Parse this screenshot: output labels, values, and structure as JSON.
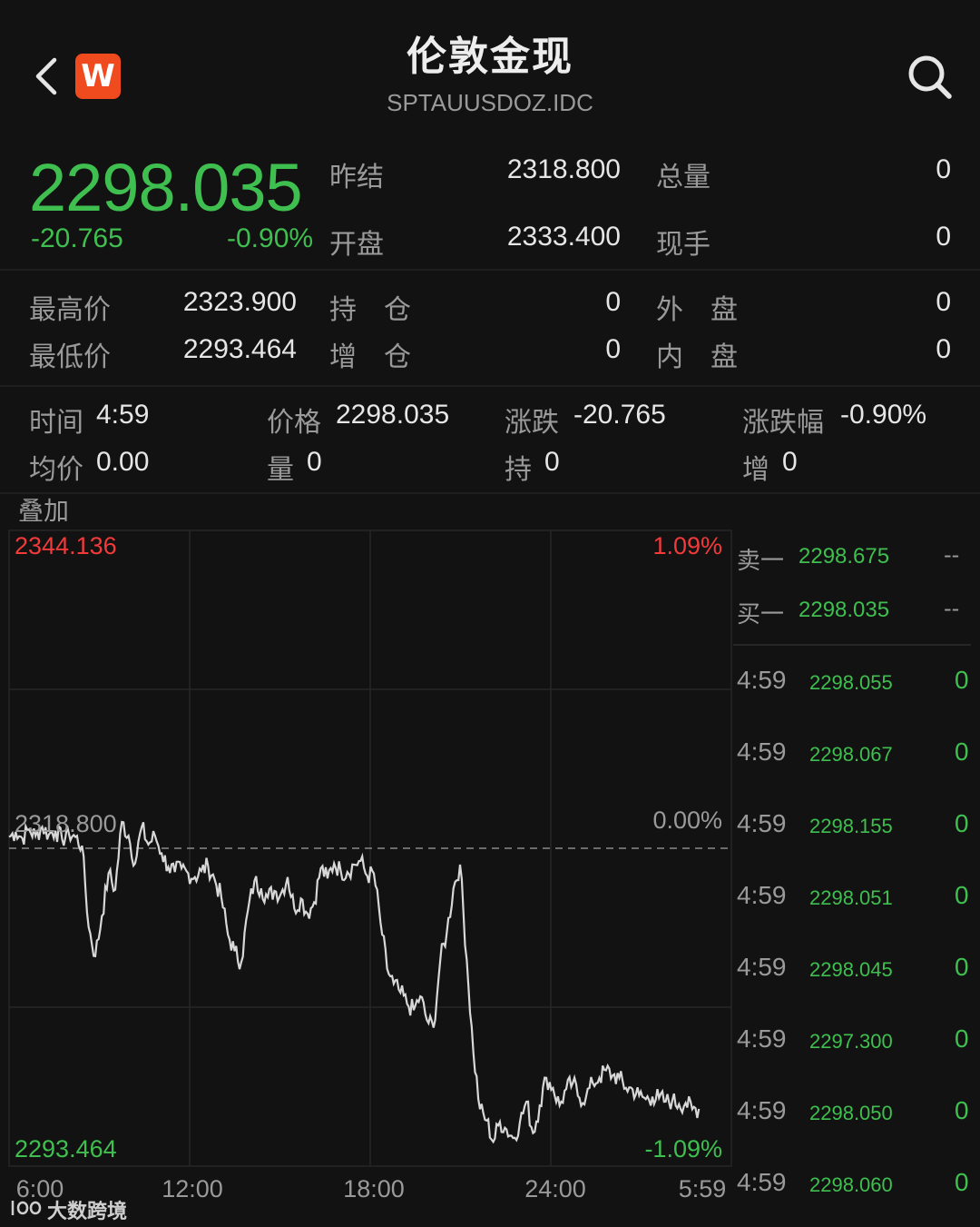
{
  "header": {
    "title": "伦敦金现",
    "subtitle": "SPTAUUSDOZ.IDC",
    "brand_letter": "W"
  },
  "quote": {
    "last": "2298.035",
    "change": "-20.765",
    "change_pct": "-0.90%",
    "prev_settle_label": "昨结",
    "prev_settle": "2318.800",
    "total_vol_label": "总量",
    "total_vol": "0",
    "open_label": "开盘",
    "open": "2333.400",
    "current_hand_label": "现手",
    "current_hand": "0"
  },
  "stats": {
    "high_label": "最高价",
    "high": "2323.900",
    "low_label": "最低价",
    "low": "2293.464",
    "hold_label": "持　仓",
    "hold": "0",
    "add_label": "增　仓",
    "add": "0",
    "outer_label": "外　盘",
    "outer": "0",
    "inner_label": "内　盘",
    "inner": "0"
  },
  "cursor": {
    "time_label": "时间",
    "time": "4:59",
    "price_label": "价格",
    "price": "2298.035",
    "chg_label": "涨跌",
    "chg": "-20.765",
    "chg_pct_label": "涨跌幅",
    "chg_pct": "-0.90%",
    "avg_label": "均价",
    "avg": "0.00",
    "vol_label": "量",
    "vol": "0",
    "hold_label": "持",
    "hold": "0",
    "add_label": "增",
    "add": "0"
  },
  "overlay_label": "叠加",
  "chart_data": {
    "type": "line",
    "y_max_label": "2344.136",
    "y_min_label": "2293.464",
    "y_max_pct": "1.09%",
    "y_min_pct": "-1.09%",
    "ref_label": "2318.800",
    "ref_pct": "0.00%",
    "ylim": [
      2293.464,
      2344.136
    ],
    "reference": 2318.8,
    "x_ticks": [
      "6:00",
      "12:00",
      "18:00",
      "24:00",
      "5:59"
    ],
    "series": [
      {
        "values": [
          2319.7,
          2320.1,
          2319.6,
          2320.3,
          2319.8,
          2320.5,
          2319.9,
          2320.2,
          2319.5,
          2320.0,
          2319.7,
          2319.0,
          2312.5,
          2310.2,
          2313.4,
          2316.8,
          2315.5,
          2320.9,
          2319.8,
          2317.6,
          2320.5,
          2319.1,
          2319.8,
          2318.4,
          2317.3,
          2316.9,
          2317.2,
          2316.8,
          2316.5,
          2317.0,
          2317.4,
          2316.3,
          2314.9,
          2311.9,
          2310.6,
          2309.7,
          2313.8,
          2316.2,
          2315.6,
          2314.9,
          2315.4,
          2315.2,
          2316.5,
          2314.0,
          2314.8,
          2313.6,
          2314.5,
          2317.2,
          2316.4,
          2317.6,
          2317.0,
          2316.9,
          2317.5,
          2317.8,
          2316.6,
          2316.8,
          2312.9,
          2309.2,
          2308.0,
          2307.3,
          2306.4,
          2305.9,
          2307.0,
          2305.1,
          2304.5,
          2309.8,
          2312.1,
          2315.6,
          2317.5,
          2309.9,
          2302.5,
          2298.0,
          2297.1,
          2295.4,
          2297.0,
          2296.4,
          2295.7,
          2296.9,
          2298.6,
          2296.1,
          2298.3,
          2300.5,
          2299.7,
          2298.3,
          2299.6,
          2300.1,
          2298.9,
          2299.0,
          2300.1,
          2300.5,
          2301.1,
          2300.7,
          2300.5,
          2299.7,
          2299.6,
          2299.1,
          2298.8,
          2299.0,
          2298.9,
          2298.6,
          2298.7,
          2298.4,
          2298.5,
          2298.0,
          2298.035
        ]
      }
    ]
  },
  "order_book": {
    "ask_label": "卖一",
    "ask_price": "2298.675",
    "ask_vol": "--",
    "bid_label": "买一",
    "bid_price": "2298.035",
    "bid_vol": "--"
  },
  "ticks": [
    {
      "time": "4:59",
      "price": "2298.055",
      "vol": "0"
    },
    {
      "time": "4:59",
      "price": "2298.067",
      "vol": "0"
    },
    {
      "time": "4:59",
      "price": "2298.155",
      "vol": "0"
    },
    {
      "time": "4:59",
      "price": "2298.051",
      "vol": "0"
    },
    {
      "time": "4:59",
      "price": "2298.045",
      "vol": "0"
    },
    {
      "time": "4:59",
      "price": "2297.300",
      "vol": "0"
    },
    {
      "time": "4:59",
      "price": "2298.050",
      "vol": "0"
    },
    {
      "time": "4:59",
      "price": "2298.060",
      "vol": "0"
    }
  ],
  "watermark": "大数跨境",
  "colors": {
    "up": "#f23a3a",
    "down": "#3fbf4f",
    "background": "#121212",
    "price_line": "#d8d8d8",
    "logo": "#f04a1f"
  }
}
